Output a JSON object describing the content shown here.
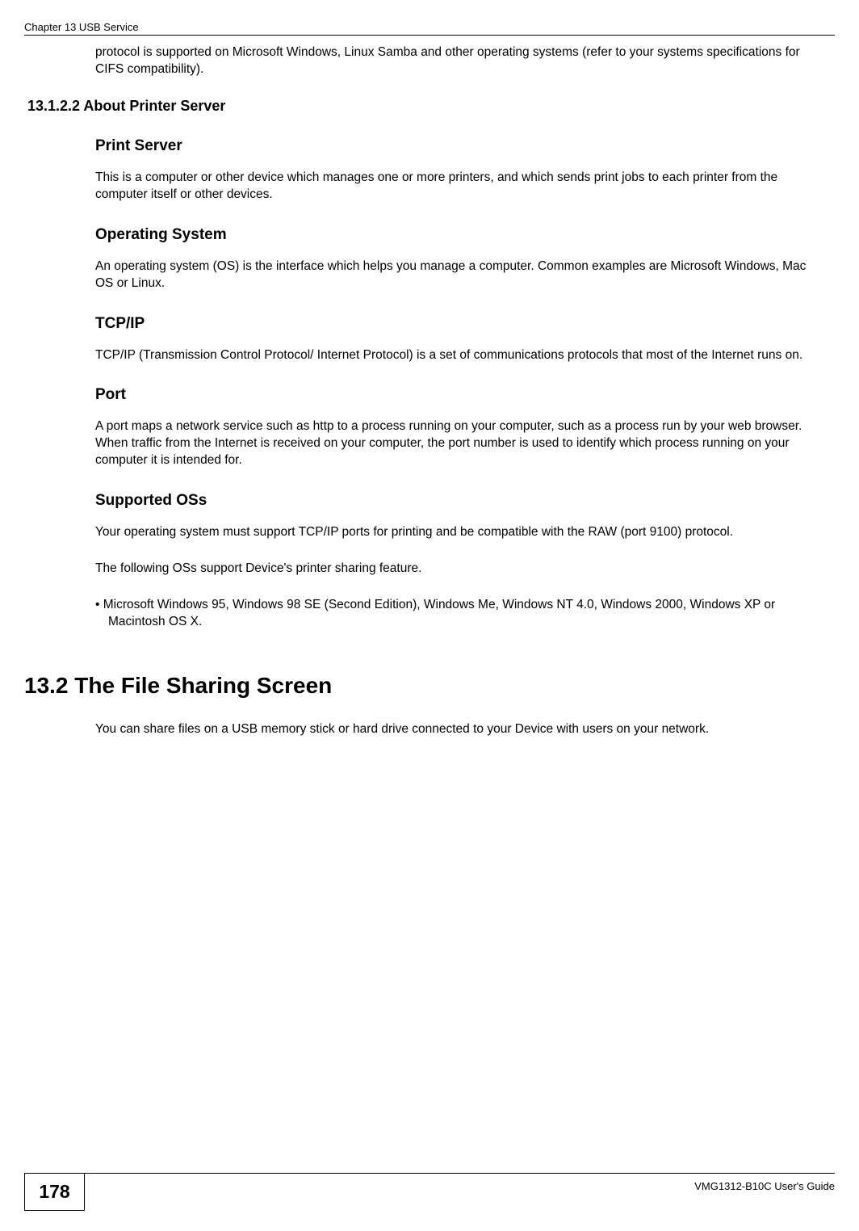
{
  "header": {
    "chapter": "Chapter 13 USB Service"
  },
  "intro_text": "protocol is supported on Microsoft Windows, Linux Samba and other operating systems (refer to your systems specifications for CIFS compatibility).",
  "section_13_1_2_2": {
    "heading": "13.1.2.2  About Printer Server",
    "print_server": {
      "title": "Print Server",
      "body": "This is a computer or other device which manages one or more printers, and which sends print jobs to each printer from the computer itself or other devices."
    },
    "operating_system": {
      "title": "Operating System",
      "body": "An operating system (OS) is the interface which helps you manage a computer. Common examples are Microsoft Windows, Mac OS or Linux."
    },
    "tcp_ip": {
      "title": "TCP/IP",
      "body": "TCP/IP (Transmission Control Protocol/ Internet Protocol) is a set of communications protocols that most of the Internet runs on."
    },
    "port": {
      "title": "Port",
      "body": "A port maps a network service such as http to a process running on your computer, such as a process run by your web browser. When traffic from the Internet is received on your computer, the port number is used to identify which process running on your computer it is intended for."
    },
    "supported_oss": {
      "title": "Supported OSs",
      "body1": "Your operating system must support TCP/IP ports for printing and be compatible with the RAW (port 9100) protocol.",
      "body2": "The following OSs support Device's printer sharing feature.",
      "bullet": "• Microsoft Windows 95, Windows 98 SE (Second Edition), Windows Me, Windows NT 4.0, Windows 2000, Windows XP or Macintosh OS X."
    }
  },
  "section_13_2": {
    "heading": "13.2  The File Sharing Screen",
    "body": "You can share files on a USB memory stick or hard drive connected to your Device with users on your network."
  },
  "footer": {
    "page_number": "178",
    "guide": "VMG1312-B10C User's Guide"
  }
}
